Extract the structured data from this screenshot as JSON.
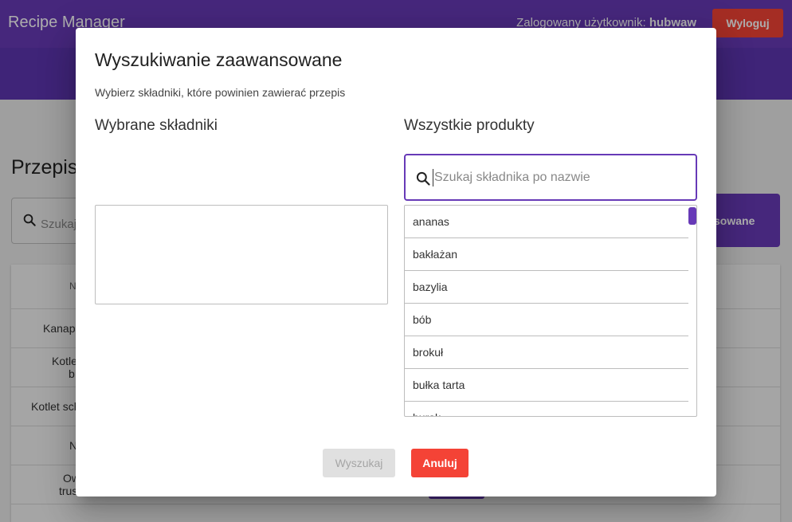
{
  "app": {
    "title": "Recipe Manager",
    "user_label": "Zalogowany użytkownik:",
    "username": "hubwaw",
    "logout_label": "Wyloguj"
  },
  "background": {
    "heading": "Przepisy",
    "search_placeholder": "Szukaj",
    "advanced_button": "sowane",
    "table": {
      "header_cell": "N",
      "rows": [
        "Kanapk",
        "Kotle",
        "b",
        "Kotlet sch",
        "N",
        "Ow",
        "trus"
      ]
    }
  },
  "dialog": {
    "title": "Wyszukiwanie zaawansowane",
    "subtitle": "Wybierz składniki, które powinien zawierać przepis",
    "selected_title": "Wybrane składniki",
    "all_products_title": "Wszystkie produkty",
    "search_placeholder": "Szukaj składnika po nazwie",
    "products": [
      "ananas",
      "bakłażan",
      "bazylia",
      "bób",
      "brokuł",
      "bułka tarta",
      "burak"
    ],
    "search_button": "Wyszukaj",
    "cancel_button": "Anuluj"
  },
  "colors": {
    "primary": "#673ab7",
    "warn": "#f44336",
    "disabled_bg": "#e0e0e0"
  },
  "icons": {
    "search": "search-icon"
  }
}
